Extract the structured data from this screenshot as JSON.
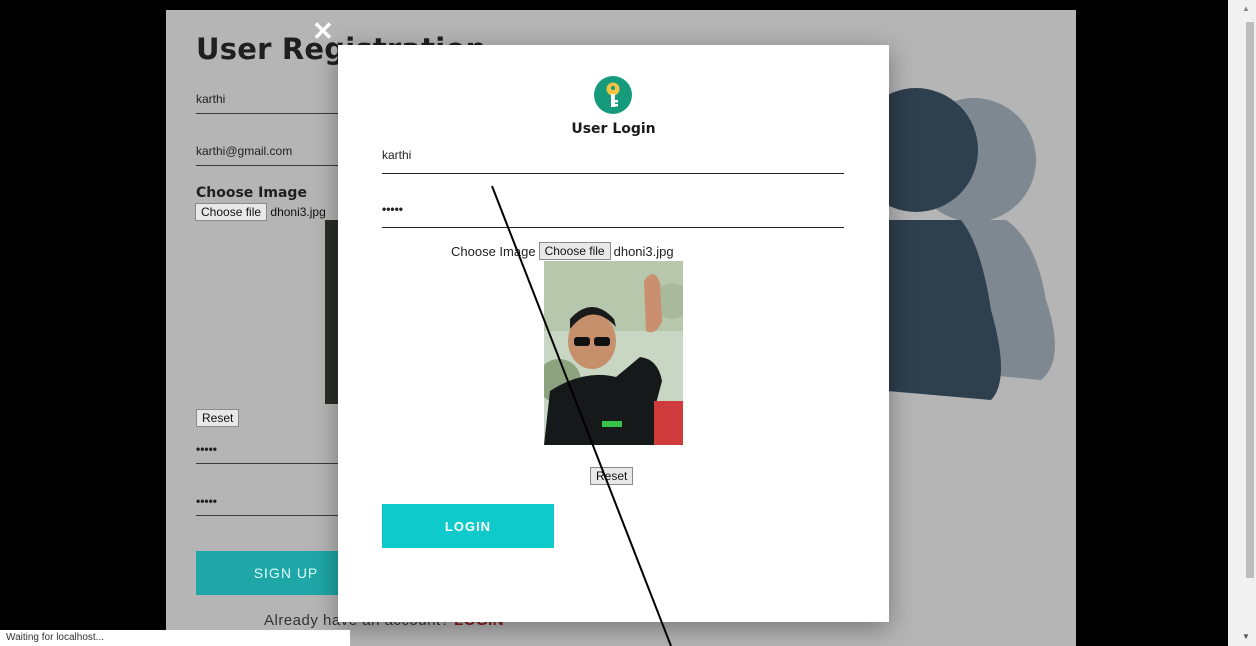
{
  "registration": {
    "title": "User Registration",
    "name_value": "karthi",
    "email_value": "karthi@gmail.com",
    "choose_image_label": "Choose Image",
    "file_button": "Choose file",
    "file_name": "dhoni3.jpg",
    "reset_label": "Reset",
    "password_value": "•••••",
    "confirm_password_value": "•••••",
    "signup_label": "SIGN UP",
    "already_text": "Already have an account?",
    "login_link": "LOGIN"
  },
  "close_icon": "✕",
  "login_modal": {
    "title": "User Login",
    "icon": "key-icon",
    "username_value": "karthi",
    "password_value": "•••••",
    "choose_image_label": "Choose Image",
    "file_button": "Choose file",
    "file_name": "dhoni3.jpg",
    "reset_label": "Reset",
    "login_label": "LOGIN"
  },
  "status_bar": "Waiting for localhost...",
  "colors": {
    "accent_teal": "#0fcaca",
    "signup_teal": "#1fa6a6",
    "key_icon_green": "#159b7c"
  }
}
